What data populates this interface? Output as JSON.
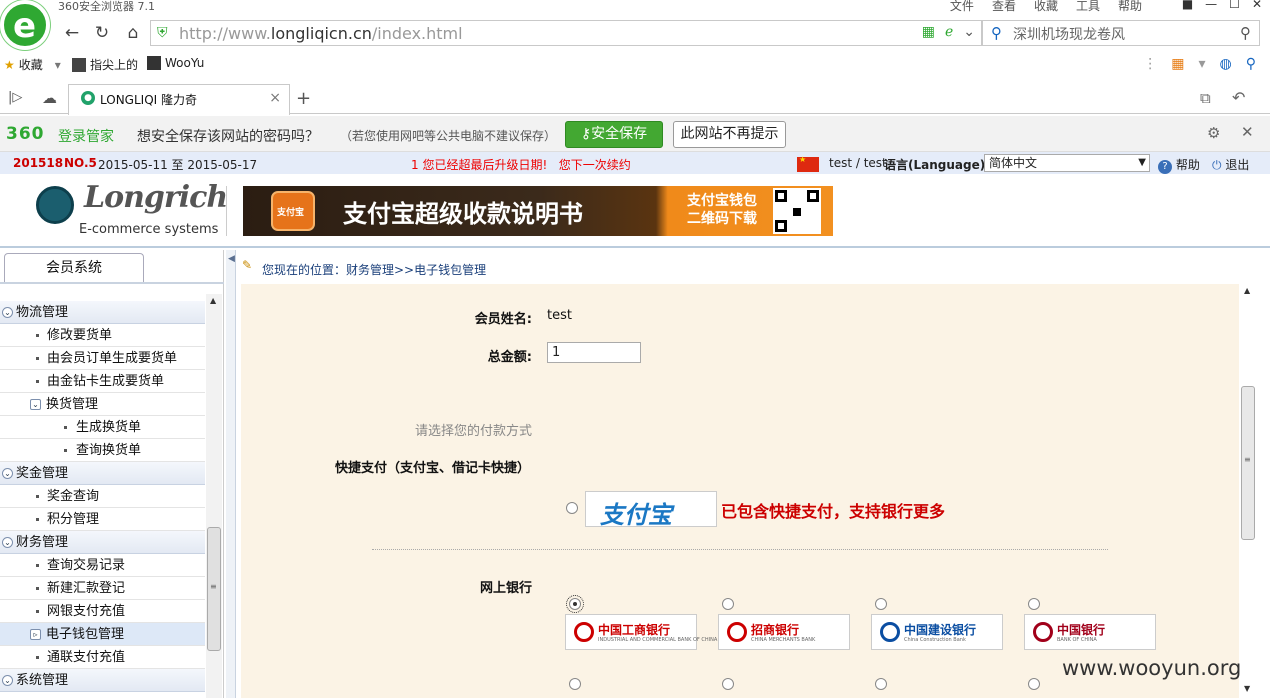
{
  "browser": {
    "window_title": "360安全浏览器 7.1",
    "menu": [
      "文件",
      "查看",
      "收藏",
      "工具",
      "帮助"
    ],
    "address_url_prefix": "http://www.",
    "address_url_domain": "longliqicn.cn",
    "address_url_path": "/index.html",
    "search_text": "深圳机场现龙卷风",
    "bookmarks": [
      "收藏",
      "指尖上的",
      "WooYu"
    ],
    "tab_title": "LONGLIQI 隆力奇",
    "accent": "#2fa832"
  },
  "password_bar": {
    "brand": "360",
    "label": "登录管家",
    "question": "想安全保存该网站的密码吗？",
    "note": "（若您使用网吧等公共电脑不建议保存）",
    "save_button": "安全保存",
    "never_button": "此网站不再提示"
  },
  "infobar": {
    "code": "201518",
    "period_no": "NO.5",
    "date_range": "2015-05-11 至 2015-05-17",
    "marquee": "1 您已经超最后升级日期!   您下一次续约",
    "user": "test / test",
    "language_label": "语言(Language):",
    "language_value": "简体中文",
    "help": "帮助",
    "logout": "退出"
  },
  "header": {
    "brand": "Longrich",
    "subtitle": "E-commerce systems",
    "banner_title": "支付宝超级收款说明书",
    "banner_download_line1": "支付宝钱包",
    "banner_download_line2": "二维码下载",
    "banner_icon_text": "支付宝"
  },
  "sidebar": {
    "tab": "会员系统",
    "items": [
      {
        "label": "物流管理",
        "type": "group"
      },
      {
        "label": "修改要货单",
        "type": "item"
      },
      {
        "label": "由会员订单生成要货单",
        "type": "item"
      },
      {
        "label": "由金钻卡生成要货单",
        "type": "item"
      },
      {
        "label": "换货管理",
        "type": "subgroup"
      },
      {
        "label": "生成换货单",
        "type": "subitem"
      },
      {
        "label": "查询换货单",
        "type": "subitem"
      },
      {
        "label": "奖金管理",
        "type": "group"
      },
      {
        "label": "奖金查询",
        "type": "item"
      },
      {
        "label": "积分管理",
        "type": "item"
      },
      {
        "label": "财务管理",
        "type": "group"
      },
      {
        "label": "查询交易记录",
        "type": "item"
      },
      {
        "label": "新建汇款登记",
        "type": "item"
      },
      {
        "label": "网银支付充值",
        "type": "item"
      },
      {
        "label": "电子钱包管理",
        "type": "active"
      },
      {
        "label": "通联支付充值",
        "type": "item"
      },
      {
        "label": "系统管理",
        "type": "group"
      }
    ]
  },
  "content": {
    "breadcrumb": "您现在的位置：财务管理>>电子钱包管理",
    "member_name_label": "会员姓名:",
    "member_name": "test",
    "total_label": "总金额:",
    "total_value": "1",
    "choose_payment": "请选择您的付款方式",
    "quick_pay_title": "快捷支付（支付宝、借记卡快捷）",
    "alipay_logo": "支付宝",
    "alipay_note": "已包含快捷支付，支持银行更多",
    "online_bank_title": "网上银行",
    "banks": [
      {
        "name": "中国工商银行",
        "sub": "INDUSTRIAL AND COMMERCIAL BANK OF CHINA",
        "color": "#c00",
        "selected": true
      },
      {
        "name": "招商银行",
        "sub": "CHINA MERCHANTS BANK",
        "color": "#c00",
        "selected": false
      },
      {
        "name": "中国建设银行",
        "sub": "China Construction Bank",
        "color": "#0b4ea2",
        "selected": false
      },
      {
        "name": "中国银行",
        "sub": "BANK OF CHINA",
        "color": "#a1001a",
        "selected": false
      }
    ]
  },
  "watermark": "www.wooyun.org"
}
